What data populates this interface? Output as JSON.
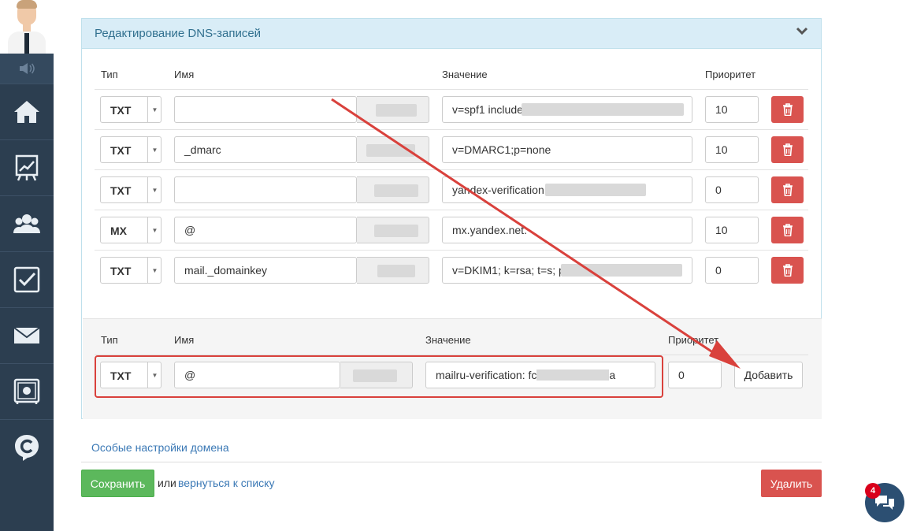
{
  "panel": {
    "title": "Редактирование DNS-записей"
  },
  "headers": {
    "type": "Тип",
    "name": "Имя",
    "value": "Значение",
    "priority": "Приоритет"
  },
  "records": [
    {
      "type": "TXT",
      "name": "",
      "value": "v=spf1 include:",
      "priority": "10"
    },
    {
      "type": "TXT",
      "name": "_dmarc",
      "value": "v=DMARC1;p=none",
      "priority": "10"
    },
    {
      "type": "TXT",
      "name": "",
      "value": "yandex-verification:",
      "priority": "0"
    },
    {
      "type": "MX",
      "name": "@",
      "value": "mx.yandex.net.",
      "priority": "10"
    },
    {
      "type": "TXT",
      "name": "mail._domainkey",
      "value": "v=DKIM1; k=rsa; t=s; p=",
      "priority": "0"
    }
  ],
  "new_record": {
    "type": "TXT",
    "name": "@",
    "value_start": "mailru-verification: fc",
    "value_end": "a",
    "priority": "0",
    "add_label": "Добавить"
  },
  "footer": {
    "special_link": "Особые настройки домена",
    "save_label": "Сохранить",
    "or_text": "или",
    "back_link": "вернуться к списку",
    "delete_label": "Удалить"
  },
  "chat": {
    "badge": "4"
  },
  "colors": {
    "sidebar": "#2c3e50",
    "danger": "#d9534f",
    "success": "#5cb85c",
    "link": "#3a78b5",
    "annotation": "#d9413c"
  }
}
